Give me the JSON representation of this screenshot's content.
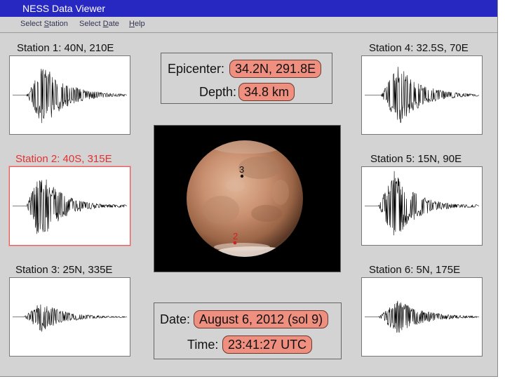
{
  "window": {
    "title": "NESS Data Viewer"
  },
  "menu": [
    {
      "pre": "Select ",
      "key": "S",
      "post": "tation"
    },
    {
      "pre": "Select ",
      "key": "D",
      "post": "ate"
    },
    {
      "pre": "",
      "key": "H",
      "post": "elp"
    }
  ],
  "stations": [
    {
      "label": "Station 1: 40N, 210E",
      "selected": false
    },
    {
      "label": "Station 2: 40S, 315E",
      "selected": true
    },
    {
      "label": "Station 3: 25N, 335E",
      "selected": false
    },
    {
      "label": "Station 4: 32.5S, 70E",
      "selected": false
    },
    {
      "label": "Station 5: 15N, 90E",
      "selected": false
    },
    {
      "label": "Station 6: 5N, 175E",
      "selected": false
    }
  ],
  "event": {
    "epicenter_label": "Epicenter:",
    "epicenter_value": "34.2N, 291.8E",
    "depth_label": "Depth:",
    "depth_value": "34.8 km",
    "date_label": "Date:",
    "date_value": "August 6, 2012 (sol 9)",
    "time_label": "Time:",
    "time_value": "23:41:27 UTC"
  },
  "globe": {
    "markers": [
      {
        "label": "3",
        "color": "#111111"
      },
      {
        "label": "2",
        "color": "#d42020"
      }
    ]
  },
  "colors": {
    "titlebar": "#2727c2",
    "selected_station": "#e53030",
    "value_fill": "#ef8f7f",
    "window_bg": "#d3d3d3"
  }
}
